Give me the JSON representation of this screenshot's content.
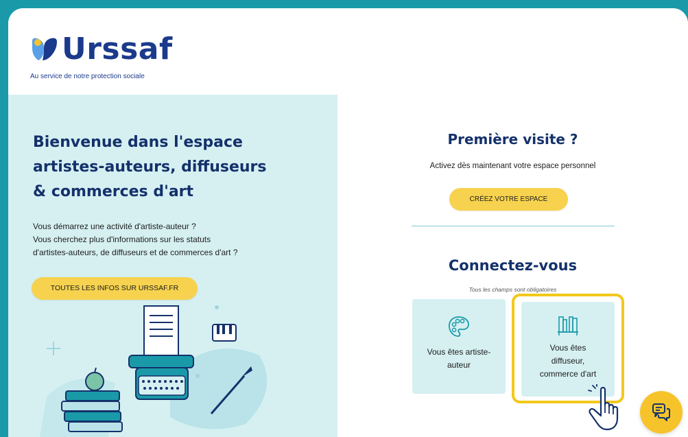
{
  "header": {
    "brand": "Urssaf",
    "tagline": "Au service de notre protection sociale"
  },
  "left": {
    "title_lines": [
      "Bienvenue dans l'espace",
      "artistes-auteurs, diffuseurs",
      "& commerces d'art"
    ],
    "intro_lines": [
      "Vous démarrez une activité d'artiste-auteur ?",
      "Vous cherchez plus d'informations sur les statuts",
      "d'artistes-auteurs, de diffuseurs et de commerces d'art ?"
    ],
    "infos_button": "TOUTES LES INFOS SUR URSSAF.FR"
  },
  "right": {
    "first_visit_title": "Première visite ?",
    "first_visit_text": "Activez dès maintenant votre espace personnel",
    "create_button": "CRÉEZ VOTRE ESPACE",
    "connect_title": "Connectez-vous",
    "required_note": "Tous les champs sont obligatoires",
    "cards": [
      {
        "lines": [
          "Vous êtes artiste-",
          "auteur"
        ],
        "icon": "palette-icon"
      },
      {
        "lines": [
          "Vous êtes",
          "diffuseur,",
          "commerce d'art"
        ],
        "icon": "bookshelf-icon"
      }
    ]
  },
  "colors": {
    "accent_teal": "#1a9aa8",
    "panel_bg": "#d6f0f2",
    "title_navy": "#14316b",
    "button_yellow": "#f6d24e",
    "highlight_yellow": "#f2c81c"
  },
  "chat_button": {
    "icon": "chat-icon"
  },
  "cursor": {
    "icon": "hand-pointer-icon"
  }
}
